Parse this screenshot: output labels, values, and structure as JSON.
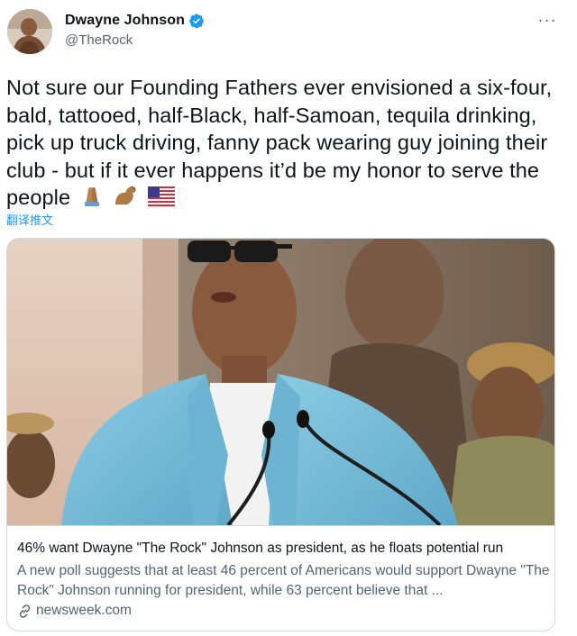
{
  "user": {
    "display_name": "Dwayne Johnson",
    "handle": "@TheRock",
    "verified": true
  },
  "tweet": {
    "text": "Not sure our Founding Fathers ever envisioned a six-four, bald, tattooed, half-Black, half-Samoan, tequila drinking, pick up truck driving, fanny pack wearing guy joining their club - but if it ever happens it’d be my honor to serve the people",
    "emojis": [
      "folded-hands-icon",
      "flexed-biceps-icon",
      "us-flag-icon"
    ],
    "translate_label": "翻译推文"
  },
  "card": {
    "title": "46% want Dwayne \"The Rock\" Johnson as president, as he floats potential run",
    "description": "A new poll suggests that at least 46 percent of Americans would support Dwayne \"The Rock\" Johnson running for president, while 63 percent believe that ...",
    "source": "newsweek.com"
  },
  "colors": {
    "link_blue": "#1d9bf0",
    "secondary_text": "#536471",
    "border": "#cfd9de",
    "jacket": "#7fc3dd"
  }
}
